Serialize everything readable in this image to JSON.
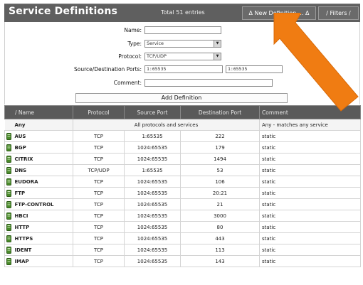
{
  "header": {
    "title": "Service Definitions",
    "total": "Total 51 entries",
    "new_definition": "Δ New Definition ... Δ",
    "filters": "/ Filters /"
  },
  "form": {
    "name_label": "Name:",
    "name_value": "",
    "type_label": "Type:",
    "type_value": "Service",
    "protocol_label": "Protocol:",
    "protocol_value": "TCP/UDP",
    "ports_label": "Source/Destination Ports:",
    "source_ports": "1:65535",
    "dest_ports": "1:65535",
    "comment_label": "Comment:",
    "comment_value": "",
    "add_button": "Add Definition"
  },
  "table": {
    "columns": {
      "name": "/ Name",
      "protocol": "Protocol",
      "source": "Source Port",
      "dest": "Destination Port",
      "comment": "Comment"
    },
    "any_row": {
      "name": "Any",
      "span": "All protocols and services",
      "comment": "Any - matches any service"
    },
    "rows": [
      {
        "name": "AUS",
        "protocol": "TCP",
        "source": "1:65535",
        "dest": "222",
        "comment": "static"
      },
      {
        "name": "BGP",
        "protocol": "TCP",
        "source": "1024:65535",
        "dest": "179",
        "comment": "static"
      },
      {
        "name": "CITRIX",
        "protocol": "TCP",
        "source": "1024:65535",
        "dest": "1494",
        "comment": "static"
      },
      {
        "name": "DNS",
        "protocol": "TCP/UDP",
        "source": "1:65535",
        "dest": "53",
        "comment": "static"
      },
      {
        "name": "EUDORA",
        "protocol": "TCP",
        "source": "1024:65535",
        "dest": "106",
        "comment": "static"
      },
      {
        "name": "FTP",
        "protocol": "TCP",
        "source": "1024:65535",
        "dest": "20:21",
        "comment": "static"
      },
      {
        "name": "FTP-CONTROL",
        "protocol": "TCP",
        "source": "1024:65535",
        "dest": "21",
        "comment": "static"
      },
      {
        "name": "HBCI",
        "protocol": "TCP",
        "source": "1024:65535",
        "dest": "3000",
        "comment": "static"
      },
      {
        "name": "HTTP",
        "protocol": "TCP",
        "source": "1024:65535",
        "dest": "80",
        "comment": "static"
      },
      {
        "name": "HTTPS",
        "protocol": "TCP",
        "source": "1024:65535",
        "dest": "443",
        "comment": "static"
      },
      {
        "name": "IDENT",
        "protocol": "TCP",
        "source": "1024:65535",
        "dest": "113",
        "comment": "static"
      },
      {
        "name": "IMAP",
        "protocol": "TCP",
        "source": "1024:65535",
        "dest": "143",
        "comment": "static"
      }
    ]
  },
  "colors": {
    "header_bg": "#5f5f5f",
    "arrow": "#f07c12",
    "service_icon": "#4a8a2a"
  },
  "icons": {
    "row_icon": "server-icon",
    "type_dropdown": "chevron-down-icon",
    "annotation": "arrow-icon"
  }
}
